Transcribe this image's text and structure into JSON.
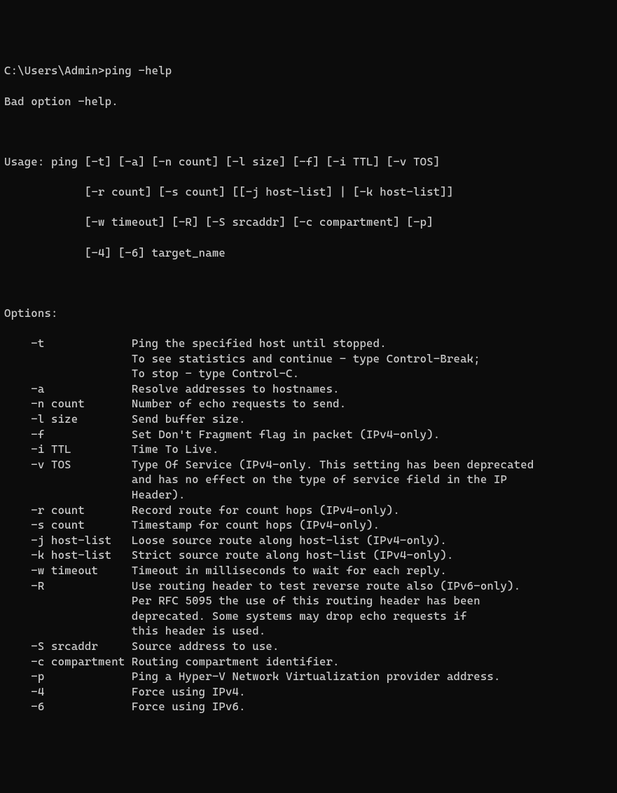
{
  "prompt": "C:\\Users\\Admin>",
  "command": "ping -help",
  "error": "Bad option -help.",
  "usage": {
    "label": "Usage:",
    "lines": [
      "ping [-t] [-a] [-n count] [-l size] [-f] [-i TTL] [-v TOS]",
      "[-r count] [-s count] [[-j host-list] | [-k host-list]]",
      "[-w timeout] [-R] [-S srcaddr] [-c compartment] [-p]",
      "[-4] [-6] target_name"
    ]
  },
  "options_label": "Options:",
  "options": [
    {
      "flag": "-t",
      "desc": [
        "Ping the specified host until stopped.",
        "To see statistics and continue - type Control-Break;",
        "To stop - type Control-C."
      ]
    },
    {
      "flag": "-a",
      "desc": [
        "Resolve addresses to hostnames."
      ]
    },
    {
      "flag": "-n count",
      "desc": [
        "Number of echo requests to send."
      ]
    },
    {
      "flag": "-l size",
      "desc": [
        "Send buffer size."
      ]
    },
    {
      "flag": "-f",
      "desc": [
        "Set Don't Fragment flag in packet (IPv4-only)."
      ]
    },
    {
      "flag": "-i TTL",
      "desc": [
        "Time To Live."
      ]
    },
    {
      "flag": "-v TOS",
      "desc": [
        "Type Of Service (IPv4-only. This setting has been deprecated",
        "and has no effect on the type of service field in the IP",
        "Header)."
      ]
    },
    {
      "flag": "-r count",
      "desc": [
        "Record route for count hops (IPv4-only)."
      ]
    },
    {
      "flag": "-s count",
      "desc": [
        "Timestamp for count hops (IPv4-only)."
      ]
    },
    {
      "flag": "-j host-list",
      "desc": [
        "Loose source route along host-list (IPv4-only)."
      ]
    },
    {
      "flag": "-k host-list",
      "desc": [
        "Strict source route along host-list (IPv4-only)."
      ]
    },
    {
      "flag": "-w timeout",
      "desc": [
        "Timeout in milliseconds to wait for each reply."
      ]
    },
    {
      "flag": "-R",
      "desc": [
        "Use routing header to test reverse route also (IPv6-only).",
        "Per RFC 5095 the use of this routing header has been",
        "deprecated. Some systems may drop echo requests if",
        "this header is used."
      ]
    },
    {
      "flag": "-S srcaddr",
      "desc": [
        "Source address to use."
      ]
    },
    {
      "flag": "-c compartment",
      "desc": [
        "Routing compartment identifier."
      ]
    },
    {
      "flag": "-p",
      "desc": [
        "Ping a Hyper-V Network Virtualization provider address."
      ]
    },
    {
      "flag": "-4",
      "desc": [
        "Force using IPv4."
      ]
    },
    {
      "flag": "-6",
      "desc": [
        "Force using IPv6."
      ]
    }
  ]
}
